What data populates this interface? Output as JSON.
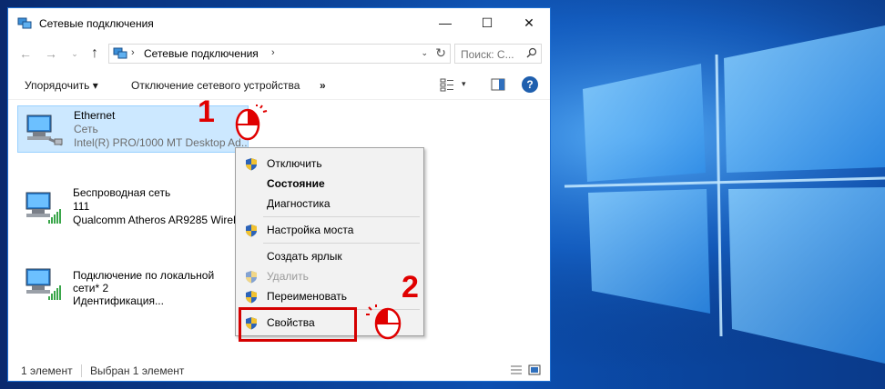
{
  "window": {
    "title": "Сетевые подключения",
    "minimize_symbol": "—",
    "maximize_symbol": "☐",
    "close_symbol": "✕"
  },
  "navigation": {
    "back_symbol": "←",
    "forward_symbol": "→",
    "dropdown_symbol": "⌄",
    "up_symbol": "↑",
    "breadcrumb_sep": "›",
    "address_path": "Сетевые подключения",
    "address_dropdown_symbol": "⌄",
    "refresh_symbol": "↻",
    "search_placeholder": "Поиск: С..."
  },
  "toolbar": {
    "organize_label": "Упорядочить ▾",
    "disable_label": "Отключение сетевого устройства",
    "more_label": "»",
    "view_dropdown_symbol": "▾",
    "help_label": "?"
  },
  "connections": [
    {
      "name": "Ethernet",
      "network": "Сеть",
      "device": "Intel(R) PRO/1000 MT Desktop Ad...",
      "selected": true
    },
    {
      "name": "Беспроводная сеть",
      "network": "111",
      "device": "Qualcomm Atheros AR9285 Wirele...",
      "selected": false
    },
    {
      "name": "Подключение по локальной",
      "network": "сети* 2",
      "device": "Идентификация...",
      "selected": false
    }
  ],
  "context_menu": {
    "items": [
      {
        "label": "Отключить",
        "shield": true,
        "bold": false,
        "disabled": false
      },
      {
        "label": "Состояние",
        "shield": false,
        "bold": true,
        "disabled": false
      },
      {
        "label": "Диагностика",
        "shield": false,
        "bold": false,
        "disabled": false
      },
      {
        "label": "Настройка моста",
        "shield": true,
        "bold": false,
        "disabled": false
      },
      {
        "label": "Создать ярлык",
        "shield": false,
        "bold": false,
        "disabled": false
      },
      {
        "label": "Удалить",
        "shield": true,
        "bold": false,
        "disabled": true
      },
      {
        "label": "Переименовать",
        "shield": true,
        "bold": false,
        "disabled": false
      },
      {
        "label": "Свойства",
        "shield": true,
        "bold": false,
        "disabled": false
      }
    ]
  },
  "status": {
    "count": "1 элемент",
    "selected": "Выбран 1 элемент"
  },
  "annotations": {
    "step1": "1",
    "step2": "2",
    "highlight_color": "#d50000"
  },
  "colors": {
    "selection_bg": "#cce8ff",
    "accent": "#1e6fd1",
    "wallpaper": "#0b4fb0"
  }
}
